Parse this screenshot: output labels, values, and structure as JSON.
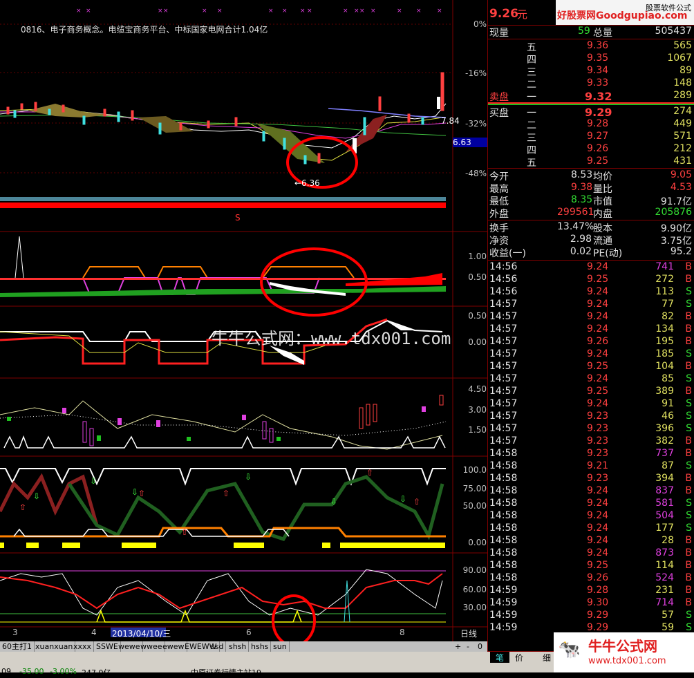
{
  "header": {
    "price": "9.26",
    "price_unit": "元",
    "watermark_top": "好股票网Goodgupiao.com",
    "watermark_top_small": "股票软件公式"
  },
  "chart": {
    "annotation": "0816、电子商务概念。电缆宝商务平台、中标国家电网合计1.04亿",
    "price_axis": [
      "0%",
      "-16%",
      "-32%",
      "-48%"
    ],
    "current_price_marker": "6.63",
    "ma_label": "7.84",
    "low_label": "←6.36",
    "signal_mark": "S",
    "ind1_axis": [
      "1.00",
      "0.50"
    ],
    "ind2_axis": [
      "0.50",
      "0.00"
    ],
    "ind3_axis": [
      "4.50",
      "3.00",
      "1.50"
    ],
    "ind4_axis": [
      "100.0",
      "75.00",
      "50.00",
      "0.00"
    ],
    "ind5_axis": [
      "90.00",
      "60.00",
      "30.00"
    ],
    "center_watermark": "牛牛公式网：www.tdx001.com",
    "date_ticks": [
      "3",
      "4",
      "6",
      "8"
    ],
    "date_highlight": "2013/04/10/三",
    "period": "日线"
  },
  "tabs": [
    "60主打1",
    "xuanxuan",
    "xxxx",
    "SSWE",
    "wewe",
    "wwee",
    "ewew",
    "EWEWW",
    "ssd",
    "shsh",
    "hshs",
    "sun"
  ],
  "tab_controls": [
    "+",
    "-",
    "0"
  ],
  "quote": {
    "vol_label": "现量",
    "vol_value": "59",
    "total_label": "总量",
    "total_value": "505437",
    "sells": [
      {
        "label": "五",
        "price": "9.36",
        "vol": "565"
      },
      {
        "label": "四",
        "price": "9.35",
        "vol": "1067"
      },
      {
        "label": "三",
        "price": "9.34",
        "vol": "89"
      },
      {
        "label": "二",
        "price": "9.33",
        "vol": "148"
      },
      {
        "label": "一",
        "price": "9.32",
        "vol": "289"
      }
    ],
    "sell_title": "卖盘",
    "buy_title": "买盘",
    "buys": [
      {
        "label": "一",
        "price": "9.29",
        "vol": "274"
      },
      {
        "label": "二",
        "price": "9.28",
        "vol": "449"
      },
      {
        "label": "三",
        "price": "9.27",
        "vol": "571"
      },
      {
        "label": "四",
        "price": "9.26",
        "vol": "212"
      },
      {
        "label": "五",
        "price": "9.25",
        "vol": "431"
      }
    ],
    "stats": [
      {
        "l1": "今开",
        "v1": "8.53",
        "l2": "均价",
        "v2": "9.05"
      },
      {
        "l1": "最高",
        "v1": "9.38",
        "l2": "量比",
        "v2": "4.53"
      },
      {
        "l1": "最低",
        "v1": "8.35",
        "l2": "市值",
        "v2": "91.7亿"
      },
      {
        "l1": "外盘",
        "v1": "299561",
        "l2": "内盘",
        "v2": "205876"
      }
    ],
    "stats2": [
      {
        "l1": "换手",
        "v1": "13.47%",
        "l2": "股本",
        "v2": "9.90亿"
      },
      {
        "l1": "净资",
        "v1": "2.98",
        "l2": "流通",
        "v2": "3.75亿"
      },
      {
        "l1": "收益(一)",
        "v1": "0.02",
        "l2": "PE(动)",
        "v2": "95.2"
      }
    ]
  },
  "ticks": [
    {
      "t": "14:56",
      "p": "9.24",
      "v": "741",
      "s": "B"
    },
    {
      "t": "14:56",
      "p": "9.25",
      "v": "272",
      "s": "B"
    },
    {
      "t": "14:56",
      "p": "9.24",
      "v": "113",
      "s": "S"
    },
    {
      "t": "14:57",
      "p": "9.24",
      "v": "77",
      "s": "S"
    },
    {
      "t": "14:57",
      "p": "9.24",
      "v": "82",
      "s": "B"
    },
    {
      "t": "14:57",
      "p": "9.24",
      "v": "134",
      "s": "B"
    },
    {
      "t": "14:57",
      "p": "9.26",
      "v": "195",
      "s": "B"
    },
    {
      "t": "14:57",
      "p": "9.24",
      "v": "185",
      "s": "S"
    },
    {
      "t": "14:57",
      "p": "9.25",
      "v": "104",
      "s": "B"
    },
    {
      "t": "14:57",
      "p": "9.24",
      "v": "85",
      "s": "S"
    },
    {
      "t": "14:57",
      "p": "9.25",
      "v": "389",
      "s": "B"
    },
    {
      "t": "14:57",
      "p": "9.24",
      "v": "91",
      "s": "S"
    },
    {
      "t": "14:57",
      "p": "9.23",
      "v": "46",
      "s": "S"
    },
    {
      "t": "14:57",
      "p": "9.23",
      "v": "396",
      "s": "S"
    },
    {
      "t": "14:57",
      "p": "9.23",
      "v": "382",
      "s": "B"
    },
    {
      "t": "14:58",
      "p": "9.23",
      "v": "737",
      "s": "B"
    },
    {
      "t": "14:58",
      "p": "9.21",
      "v": "87",
      "s": "S"
    },
    {
      "t": "14:58",
      "p": "9.23",
      "v": "394",
      "s": "B"
    },
    {
      "t": "14:58",
      "p": "9.24",
      "v": "837",
      "s": "B"
    },
    {
      "t": "14:58",
      "p": "9.24",
      "v": "581",
      "s": "S"
    },
    {
      "t": "14:58",
      "p": "9.24",
      "v": "504",
      "s": "S"
    },
    {
      "t": "14:58",
      "p": "9.24",
      "v": "177",
      "s": "S"
    },
    {
      "t": "14:58",
      "p": "9.24",
      "v": "28",
      "s": "B"
    },
    {
      "t": "14:58",
      "p": "9.24",
      "v": "873",
      "s": "B"
    },
    {
      "t": "14:58",
      "p": "9.25",
      "v": "114",
      "s": "B"
    },
    {
      "t": "14:58",
      "p": "9.26",
      "v": "524",
      "s": "B"
    },
    {
      "t": "14:59",
      "p": "9.28",
      "v": "231",
      "s": "B"
    },
    {
      "t": "14:59",
      "p": "9.30",
      "v": "714",
      "s": "B"
    },
    {
      "t": "14:59",
      "p": "9.29",
      "v": "57",
      "s": "S"
    },
    {
      "t": "14:59",
      "p": "9.29",
      "v": "59",
      "s": "S"
    }
  ],
  "right_tabs": [
    "笔",
    "价",
    "细"
  ],
  "footer_watermark": "牛牛公式网",
  "footer_url": "www.tdx001.com",
  "status": {
    "s1": "09",
    "s2": "-35.00",
    "s3": "-3.00%",
    "s4": "247.0亿",
    "s5": "中原证券行情主站19"
  }
}
